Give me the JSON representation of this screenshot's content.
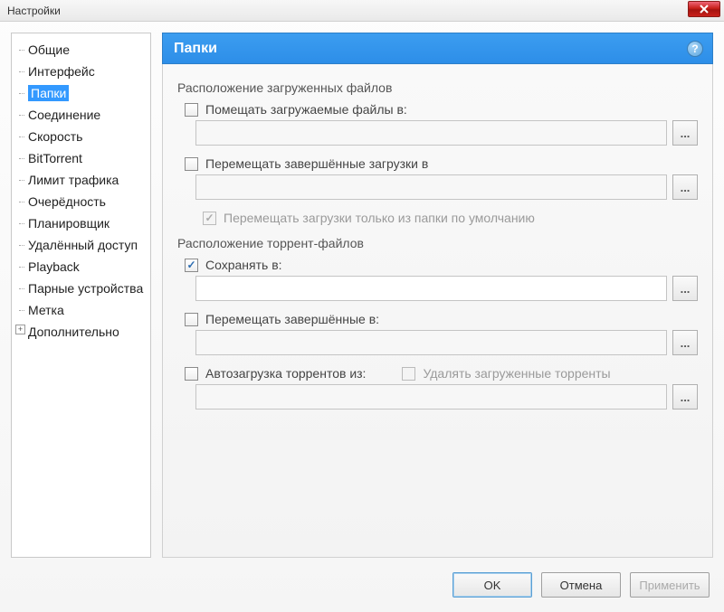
{
  "window": {
    "title": "Настройки"
  },
  "sidebar": {
    "items": [
      {
        "label": "Общие"
      },
      {
        "label": "Интерфейс"
      },
      {
        "label": "Папки",
        "selected": true
      },
      {
        "label": "Соединение"
      },
      {
        "label": "Скорость"
      },
      {
        "label": "BitTorrent"
      },
      {
        "label": "Лимит трафика"
      },
      {
        "label": "Очерёдность"
      },
      {
        "label": "Планировщик"
      },
      {
        "label": "Удалённый доступ"
      },
      {
        "label": "Playback"
      },
      {
        "label": "Парные устройства"
      },
      {
        "label": "Метка"
      }
    ],
    "advanced_label": "Дополнительно"
  },
  "panel": {
    "title": "Папки",
    "section1_title": "Расположение загруженных файлов",
    "chk_put_in": "Помещать загружаемые файлы в:",
    "chk_move_completed": "Перемещать завершённые загрузки в",
    "chk_move_only_default": "Перемещать загрузки только из папки по умолчанию",
    "section2_title": "Расположение торрент-файлов",
    "chk_save_in": "Сохранять в:",
    "save_in_path": "",
    "chk_move_completed2": "Перемещать завершённые в:",
    "chk_autoload": "Автозагрузка торрентов из:",
    "chk_delete_loaded": "Удалять загруженные торренты",
    "browse_label": "..."
  },
  "footer": {
    "ok": "OK",
    "cancel": "Отмена",
    "apply": "Применить"
  }
}
